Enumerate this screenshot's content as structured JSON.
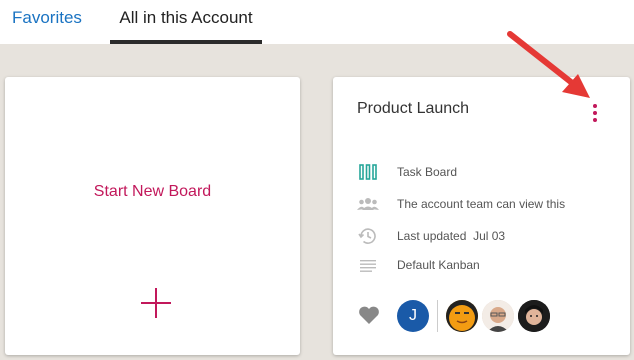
{
  "tabs": {
    "favorites": "Favorites",
    "all_in_account": "All in this Account"
  },
  "new_board": {
    "label": "Start New Board"
  },
  "board": {
    "title": "Product Launch",
    "type": "Task Board",
    "visibility": "The account team can view this",
    "last_updated_label": "Last updated",
    "last_updated_date": "Jul 03",
    "template": "Default Kanban",
    "owner_initial": "J"
  },
  "colors": {
    "accent": "#c2185b",
    "link": "#1a73c2",
    "teal_icon": "#26a69a",
    "avatar_blue": "#1a5aa8",
    "arrow": "#e53935"
  }
}
